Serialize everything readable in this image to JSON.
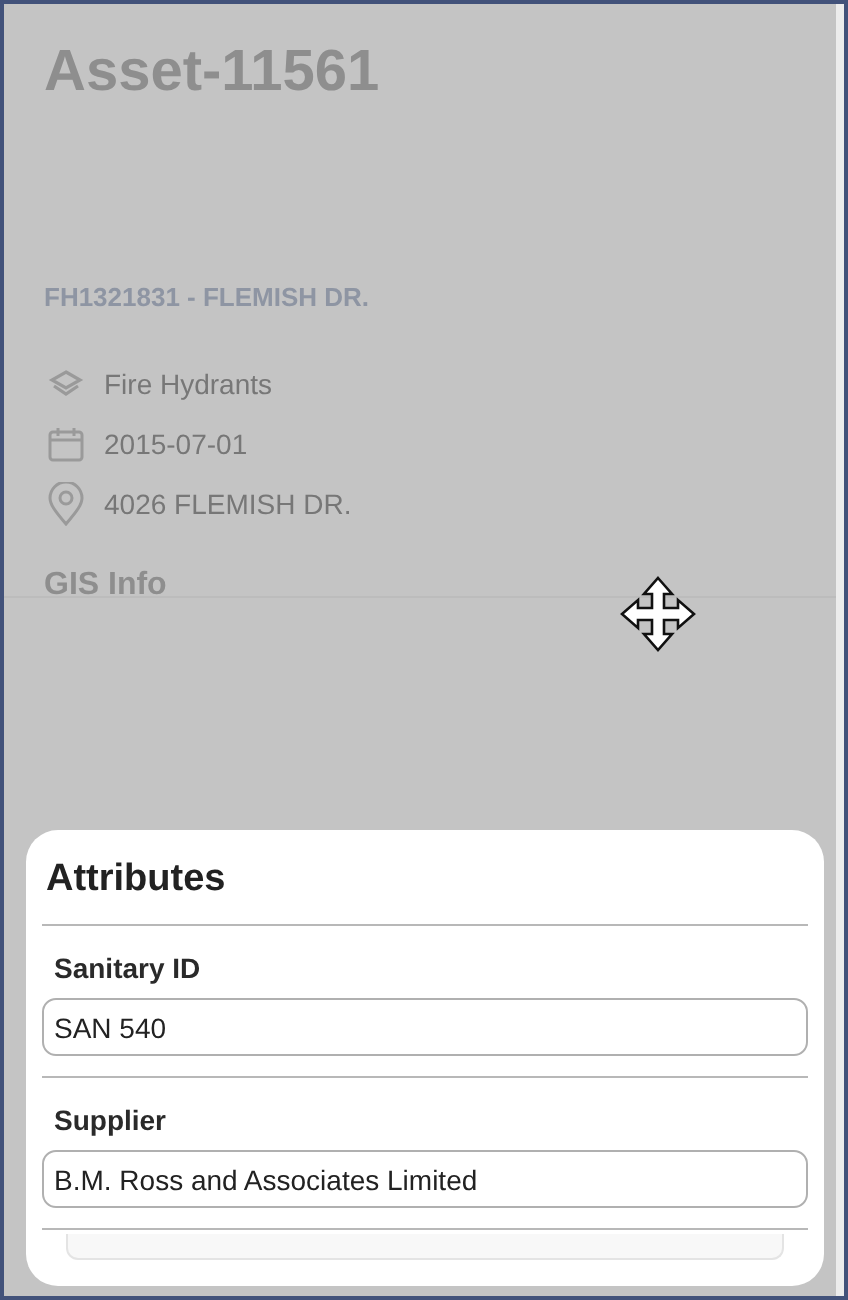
{
  "screen": {
    "title": "Asset-11561",
    "subtitle": "FH1321831 - FLEMISH DR.",
    "details": [
      {
        "kind": "category",
        "text": "Fire Hydrants"
      },
      {
        "kind": "date",
        "text": "2015-07-01"
      },
      {
        "kind": "location",
        "text": "4026 FLEMISH DR."
      }
    ],
    "section": "GIS Info"
  },
  "sheet": {
    "title": "Attributes",
    "fields": [
      {
        "label": "Sanitary ID",
        "value": "SAN 540"
      },
      {
        "label": "Supplier",
        "value": "B.M. Ross and Associates Limited"
      }
    ]
  }
}
